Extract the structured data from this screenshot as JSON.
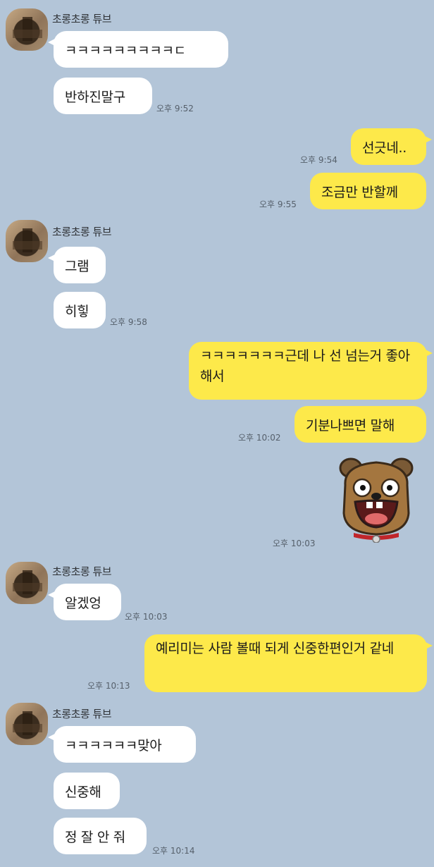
{
  "chat": {
    "sender_name": "초롱초롱 튜브",
    "messages": [
      {
        "text": "ㅋㅋㅋㅋㅋㅋㅋㅋㅋㄷ"
      },
      {
        "text": "반하진말구",
        "time": "오후 9:52"
      },
      {
        "text": "선긋네..",
        "time": "오후 9:54"
      },
      {
        "text": "조금만 반할께",
        "time": "오후 9:55"
      },
      {
        "text": "그램"
      },
      {
        "text": "히힣",
        "time": "오후 9:58"
      },
      {
        "text": "ㅋㅋㅋㅋㅋㅋㅋ근데 나 선 넘는거 좋아해서"
      },
      {
        "text": "기분나쁘면 말해",
        "time": "오후 10:02"
      },
      {
        "emoticon": "kakao-frodo-dog-grinning",
        "time": "오후 10:03"
      },
      {
        "text": "알겠엉",
        "time": "오후 10:03"
      },
      {
        "text": "예리미는 사람 볼때 되게 신중한편인거 같네",
        "time": "오후 10:13"
      },
      {
        "text": "ㅋㅋㅋㅋㅋㅋ맞아"
      },
      {
        "text": "신중해"
      },
      {
        "text": "정 잘 안 줘",
        "time": "오후 10:14"
      }
    ]
  },
  "colors": {
    "background": "#b3c5d8",
    "incoming_bubble": "#ffffff",
    "outgoing_bubble": "#fde94a"
  }
}
